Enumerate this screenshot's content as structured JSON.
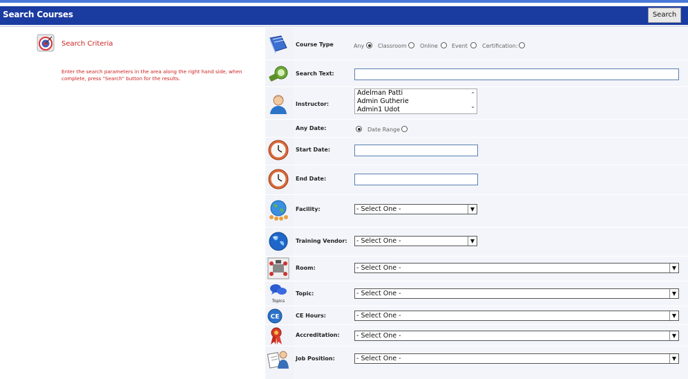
{
  "header": {
    "title": "Search Courses",
    "search_label": "Search"
  },
  "criteria": {
    "title": "Search Criteria",
    "instructions": "Enter the search parameters in the area along the right hand side, when complete, press \"Search\" button for the results."
  },
  "form": {
    "course_type": {
      "label": "Course Type",
      "options": [
        "Any",
        "Classroom",
        "Online",
        "Event",
        "Certification:"
      ],
      "selected": "Any"
    },
    "search_text": {
      "label": "Search Text:",
      "value": ""
    },
    "instructor": {
      "label": "Instructor:",
      "options": [
        "Adelman Patti",
        "Admin Gutherie",
        "Admin1 Udot"
      ]
    },
    "date_mode": {
      "label": "Any Date:",
      "alt_label": "Date Range",
      "selected": "Any Date"
    },
    "start_date": {
      "label": "Start Date:",
      "value": ""
    },
    "end_date": {
      "label": "End Date:",
      "value": ""
    },
    "facility": {
      "label": "Facility:",
      "selected": "- Select One -"
    },
    "training_vendor": {
      "label": "Training Vendor:",
      "selected": "- Select One -"
    },
    "room": {
      "label": "Room:",
      "selected": "- Select One -"
    },
    "topic": {
      "label": "Topic:",
      "selected": "- Select One -",
      "icon_caption": "Topics"
    },
    "ce_hours": {
      "label": "CE Hours:",
      "selected": "- Select One -",
      "icon_text": "CE"
    },
    "accreditation": {
      "label": "Accreditation:",
      "selected": "- Select One -"
    },
    "job_position": {
      "label": "Job Position:",
      "selected": "- Select One -"
    }
  },
  "icons": [
    "target-icon",
    "book-icon",
    "text-search-icon",
    "person-icon",
    "clock-icon",
    "globe-people-icon",
    "globe-icon",
    "room-icon",
    "topics-icon",
    "ce-badge-icon",
    "ribbon-icon",
    "job-icon"
  ],
  "colors": {
    "header": "#1a3ba0",
    "accent": "#cc2222",
    "topstrip": "#4a78d8"
  }
}
